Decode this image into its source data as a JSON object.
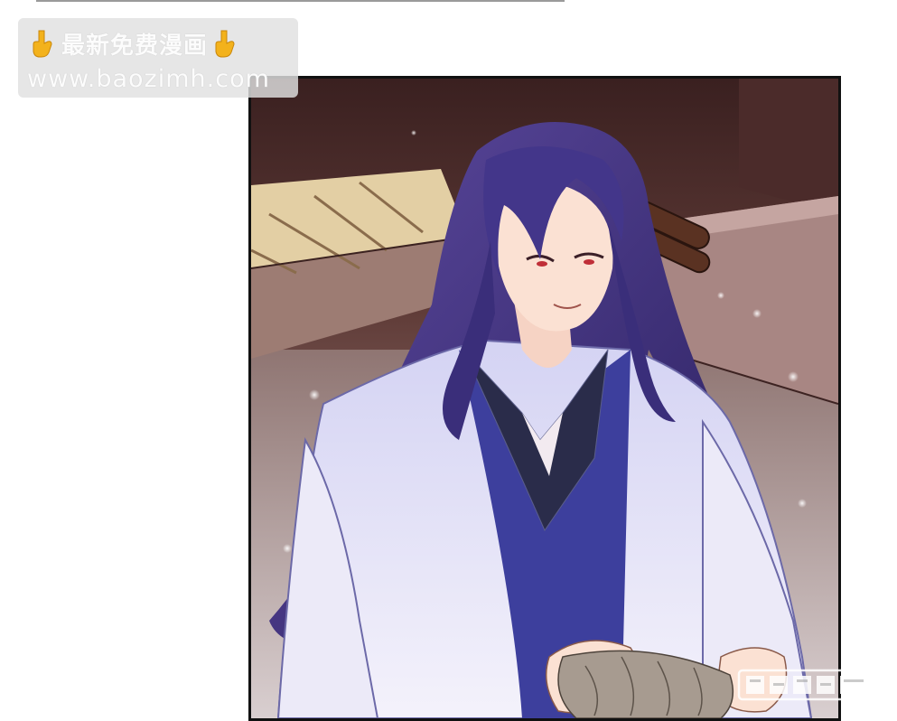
{
  "watermark": {
    "title": "最新免费漫画",
    "url": "www.baozimh.com",
    "icon_left": "pointing-down-hand-icon",
    "icon_right": "pointing-down-hand-icon"
  },
  "panel": {
    "subject": "comic-panel-illustration"
  },
  "logo": {
    "icon": "publisher-logo-watermark-icon"
  }
}
